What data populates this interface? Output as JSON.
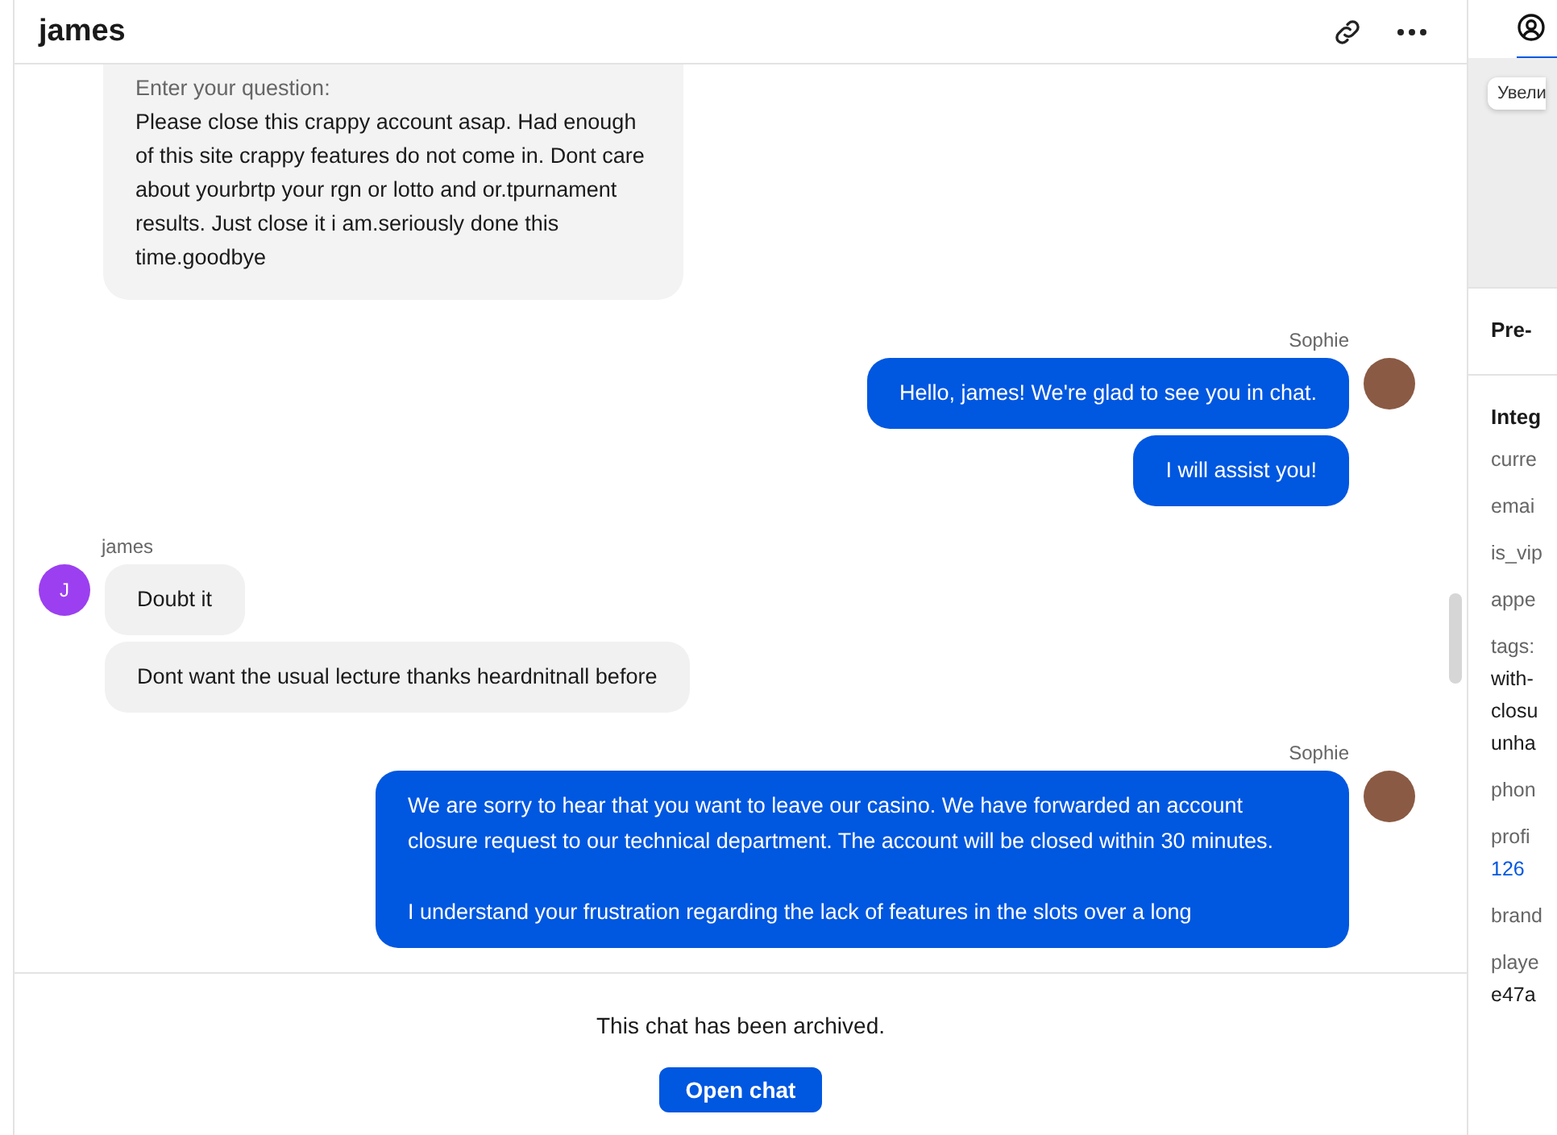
{
  "header": {
    "title": "james"
  },
  "messages": [
    {
      "kind": "form",
      "label": "Enter your question:",
      "text": "Please close this crappy account asap. Had enough of this site crappy features do not come in. Dont care about yourbrtp your rgn or lotto and or.tpurnament results. Just close it i am.seriously done this time.goodbye"
    },
    {
      "kind": "agent",
      "sender": "Sophie",
      "bubbles": [
        "Hello, james! We're glad to see you in chat.",
        "I will assist you!"
      ]
    },
    {
      "kind": "customer",
      "sender": "james",
      "initial": "J",
      "bubbles": [
        "Doubt it",
        "Dont want the usual lecture thanks heardnitnall before"
      ]
    },
    {
      "kind": "agent",
      "sender": "Sophie",
      "bubbles": [
        "We are sorry to hear that you want to leave our casino. We have forwarded an account closure request to our technical department. The account will be closed within 30 minutes.\n\nI understand your frustration regarding the lack of features in the slots over a long"
      ]
    }
  ],
  "footer": {
    "notice": "This chat has been archived.",
    "button": "Open chat"
  },
  "side_panel": {
    "map_button": "Увели",
    "sections": [
      {
        "title": "Pre-"
      },
      {
        "title": "Integ",
        "fields": [
          {
            "label": "curre"
          },
          {
            "label": "emai"
          },
          {
            "label": "is_vip"
          },
          {
            "label": "appe"
          },
          {
            "label": "tags:",
            "values": [
              "with-",
              "closu",
              "unha"
            ]
          },
          {
            "label": "phon"
          },
          {
            "label": "profi",
            "link": "126"
          },
          {
            "label": "brand"
          },
          {
            "label": "playe",
            "values": [
              "e47a"
            ]
          }
        ]
      }
    ]
  }
}
